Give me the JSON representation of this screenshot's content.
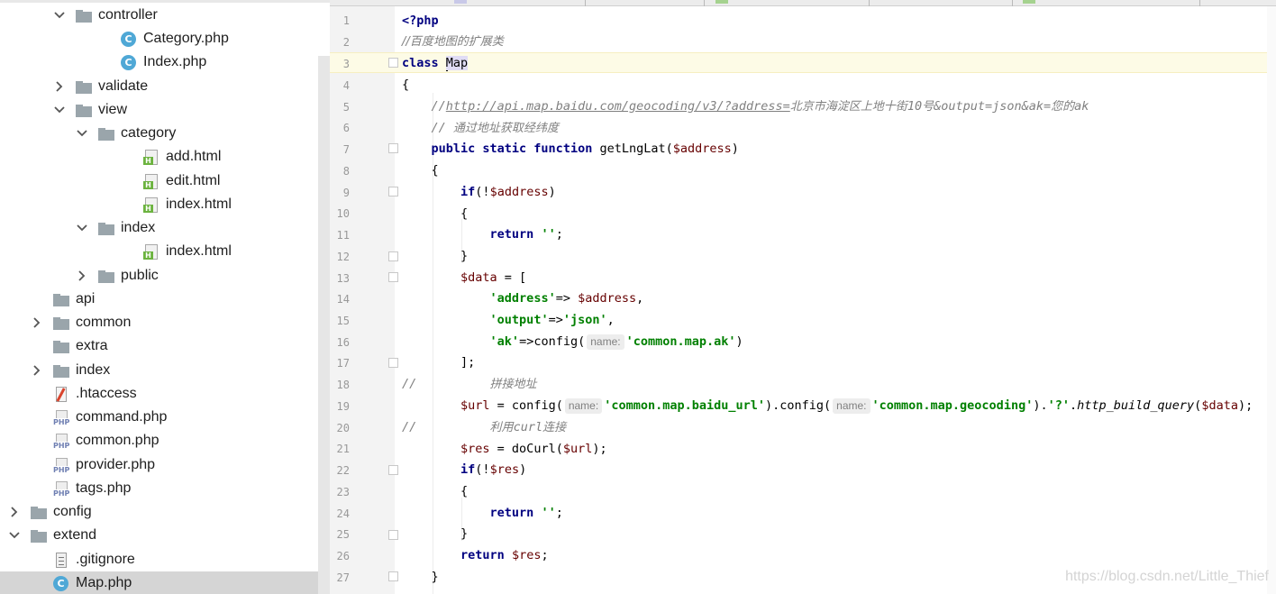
{
  "tree": {
    "items": [
      {
        "label": "controller",
        "icon": "folder-icon",
        "expanded": true
      },
      {
        "label": "Category.php",
        "icon": "php-class-icon",
        "badge": "C"
      },
      {
        "label": "Index.php",
        "icon": "php-class-icon",
        "badge": "C"
      },
      {
        "label": "validate",
        "icon": "folder-icon",
        "expanded": false
      },
      {
        "label": "view",
        "icon": "folder-icon",
        "expanded": true
      },
      {
        "label": "category",
        "icon": "folder-icon",
        "expanded": true
      },
      {
        "label": "add.html",
        "icon": "html-file-icon",
        "badge": "H"
      },
      {
        "label": "edit.html",
        "icon": "html-file-icon",
        "badge": "H"
      },
      {
        "label": "index.html",
        "icon": "html-file-icon",
        "badge": "H"
      },
      {
        "label": "index",
        "icon": "folder-icon",
        "expanded": true
      },
      {
        "label": "index.html",
        "icon": "html-file-icon",
        "badge": "H"
      },
      {
        "label": "public",
        "icon": "folder-icon",
        "expanded": false
      },
      {
        "label": "api",
        "icon": "folder-icon"
      },
      {
        "label": "common",
        "icon": "folder-icon",
        "expanded": false
      },
      {
        "label": "extra",
        "icon": "folder-icon"
      },
      {
        "label": "index",
        "icon": "folder-icon",
        "expanded": false
      },
      {
        "label": ".htaccess",
        "icon": "htaccess-file-icon"
      },
      {
        "label": "command.php",
        "icon": "php-file-icon",
        "badge": "PHP"
      },
      {
        "label": "common.php",
        "icon": "php-file-icon",
        "badge": "PHP"
      },
      {
        "label": "provider.php",
        "icon": "php-file-icon",
        "badge": "PHP"
      },
      {
        "label": "tags.php",
        "icon": "php-file-icon",
        "badge": "PHP"
      },
      {
        "label": "config",
        "icon": "folder-icon",
        "expanded": false
      },
      {
        "label": "extend",
        "icon": "folder-icon",
        "expanded": true
      },
      {
        "label": ".gitignore",
        "icon": "text-file-icon"
      },
      {
        "label": "Map.php",
        "icon": "php-class-icon",
        "badge": "C",
        "selected": true
      }
    ]
  },
  "editor": {
    "line_numbers": [
      "1",
      "2",
      "3",
      "4",
      "5",
      "6",
      "7",
      "8",
      "9",
      "10",
      "11",
      "12",
      "13",
      "14",
      "15",
      "16",
      "17",
      "18",
      "19",
      "20",
      "21",
      "22",
      "23",
      "24",
      "25",
      "26",
      "27"
    ],
    "code": {
      "l1": "<?php",
      "l2": "//百度地图的扩展类",
      "l3_kw": "class",
      "l3_name_first": "M",
      "l3_name_rest": "ap",
      "l4": "{",
      "l5_slashes": "//",
      "l5_url": "http://api.map.baidu.com/geocoding/v3/?address=",
      "l5_cn1": "北京市海淀区上地十街",
      "l5_num": "10",
      "l5_cn2": "号",
      "l5_params": "&output=json&ak=",
      "l5_cn3": "您的",
      "l5_tail": "ak",
      "l6_slashes": "// ",
      "l6_cn": "通过地址获取经纬度",
      "l7_kw": "public static function",
      "l7_fn": " getLngLat(",
      "l7_var": "$address",
      "l7_close": ")",
      "l8": "{",
      "l9_kw": "if",
      "l9_open": "(!",
      "l9_var": "$address",
      "l9_close": ")",
      "l10": "{",
      "l11_kw": "return",
      "l11_str": " ''",
      "l11_end": ";",
      "l12": "}",
      "l13_var": "$data",
      "l13_rest": " = [",
      "l14_key": "'address'",
      "l14_arrow": "=> ",
      "l14_var": "$address",
      "l14_end": ",",
      "l15_key": "'output'",
      "l15_arrow": "=>",
      "l15_val": "'json'",
      "l15_end": ",",
      "l16_key": "'ak'",
      "l16_call": "=>config(",
      "l16_hint": "name:",
      "l16_val": "'common.map.ak'",
      "l16_end": ")",
      "l17": "];",
      "l18_slashes": "//",
      "l18_cn": "拼接地址",
      "l19_var": "$url",
      "l19_call": " = config(",
      "l19_hint1": "name:",
      "l19_val1": "'common.map.baidu_url'",
      "l19_mid": ").config(",
      "l19_hint2": "name:",
      "l19_val2": "'common.map.geocoding'",
      "l19_concat": ").",
      "l19_q": "'?'",
      "l19_dot": ".",
      "l19_fn": "http_build_query",
      "l19_open": "(",
      "l19_var2": "$data",
      "l19_end": ");",
      "l20_slashes": "//",
      "l20_cn1": "利用",
      "l20_curl": "curl",
      "l20_cn2": "连接",
      "l21_var": "$res",
      "l21_call": " = doCurl(",
      "l21_var2": "$url",
      "l21_end": ");",
      "l22_kw": "if",
      "l22_open": "(!",
      "l22_var": "$res",
      "l22_close": ")",
      "l23": "{",
      "l24_kw": "return",
      "l24_str": " ''",
      "l24_end": ";",
      "l25": "}",
      "l26_kw": "return",
      "l26_var": " $res",
      "l26_end": ";",
      "l27": "}"
    }
  },
  "watermark": "https://blog.csdn.net/Little_Thief",
  "colors": {
    "keyword": "#000080",
    "string": "#008000",
    "comment": "#808080",
    "variable": "#660000",
    "caret_line": "#fdfbe6",
    "selection": "#d5d5d5"
  }
}
